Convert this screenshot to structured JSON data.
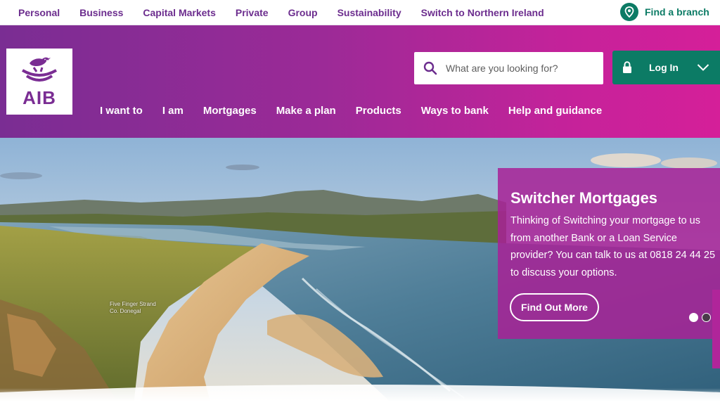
{
  "topnav": {
    "items": [
      "Personal",
      "Business",
      "Capital Markets",
      "Private",
      "Group",
      "Sustainability",
      "Switch to Northern Ireland"
    ],
    "find_branch": "Find a branch"
  },
  "logo": {
    "text": "AIB"
  },
  "search": {
    "placeholder": "What are you looking for?"
  },
  "login": {
    "label": "Log In"
  },
  "mainnav": {
    "items": [
      "I want to",
      "I am",
      "Mortgages",
      "Make a plan",
      "Products",
      "Ways to bank",
      "Help and guidance"
    ]
  },
  "hero": {
    "caption_line1": "Five Finger Strand",
    "caption_line2": "Co. Donegal",
    "promo": {
      "title": "Switcher Mortgages",
      "body": "Thinking of Switching your mortgage to us from another Bank or a Loan Service provider? You can talk to us at 0818 24 44 25 to discuss your options.",
      "button": "Find Out More"
    }
  },
  "colors": {
    "brand_purple": "#7a2d93",
    "brand_pink": "#d51f99",
    "action_green": "#0c7b65"
  }
}
